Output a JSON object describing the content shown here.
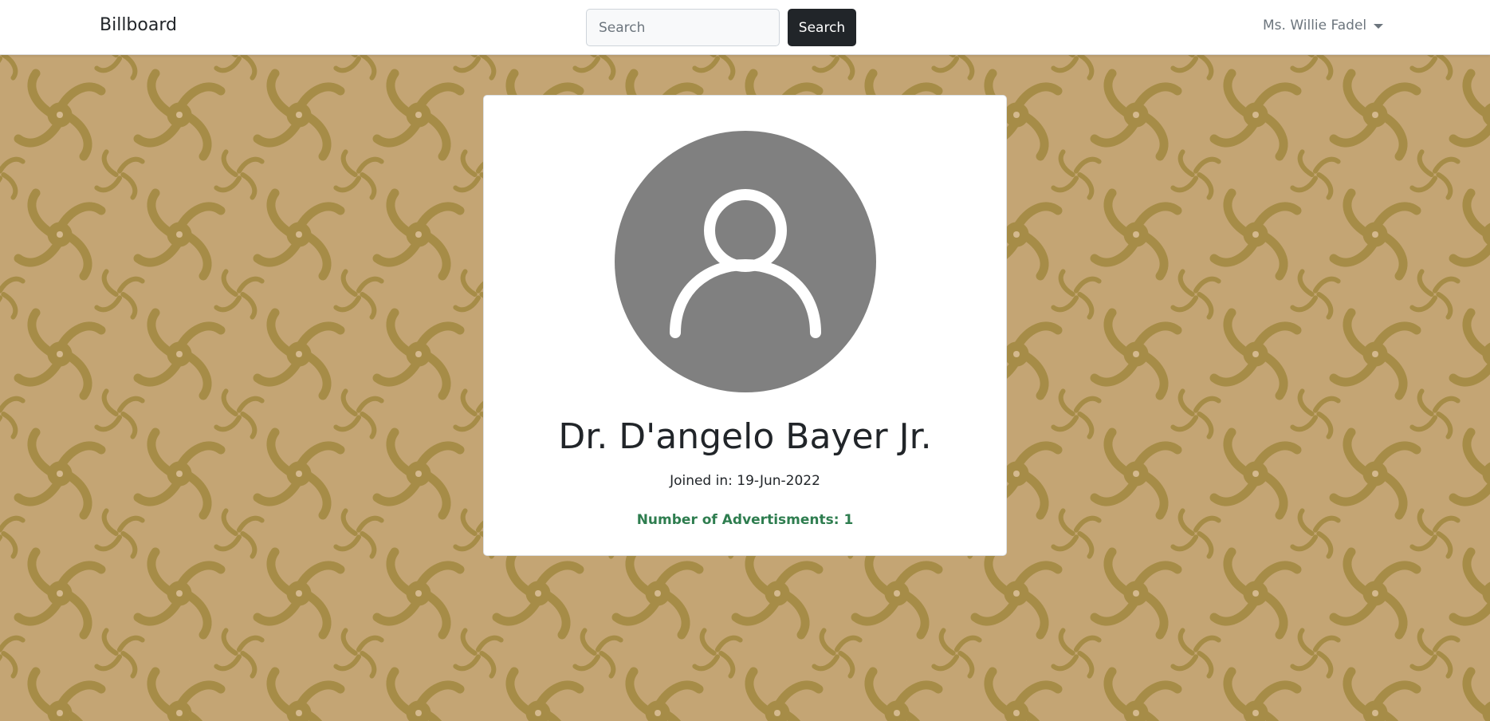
{
  "navbar": {
    "brand": "Billboard",
    "search_placeholder": "Search",
    "search_button": "Search",
    "user_name": "Ms. Willie Fadel"
  },
  "profile": {
    "name": "Dr. D'angelo Bayer Jr.",
    "joined": "Joined in: 19-Jun-2022",
    "ads_count": "Number of Advertisments: 1"
  },
  "icons": {
    "avatar": "user-avatar-icon",
    "caret": "caret-down-icon"
  },
  "colors": {
    "background": "#c4a574",
    "pattern": "#a68c47",
    "navbar": "#ffffff",
    "button": "#212529",
    "avatar_bg": "#808080",
    "ads_text": "#2e7d4f"
  }
}
